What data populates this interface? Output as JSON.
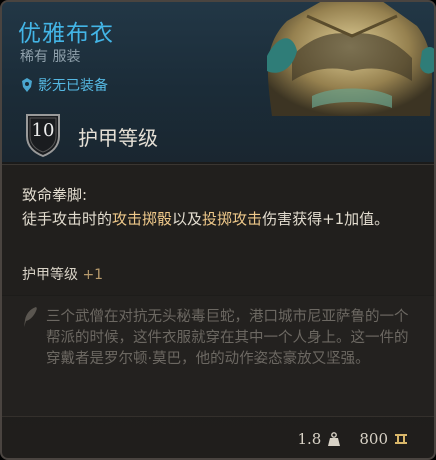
{
  "item": {
    "name": "优雅布衣",
    "rarity_type": "稀有 服装",
    "proficiency": "影无已装备"
  },
  "armor": {
    "value": "10",
    "label": "护甲等级"
  },
  "passive": {
    "title": "致命拳脚:",
    "desc_before": "徒手攻击时的",
    "desc_hl1": "攻击掷骰",
    "desc_mid": "以及",
    "desc_hl2": "投掷攻击",
    "desc_after": "伤害获得+1加值。"
  },
  "stat_bonus": {
    "label": "护甲等级",
    "value": "+1"
  },
  "lore": "三个武僧在对抗无头秘毒巨蛇，港口城市尼亚萨鲁的一个帮派的时候，这件衣服就穿在其中一个人身上。这一件的穿戴者是罗尔顿·莫巴，他的动作姿态豪放又坚强。",
  "footer": {
    "weight": "1.8",
    "value": "800"
  },
  "colors": {
    "rare_name": "#43b5e6",
    "highlight": "#eec88a",
    "lore_text": "#6c6862"
  }
}
